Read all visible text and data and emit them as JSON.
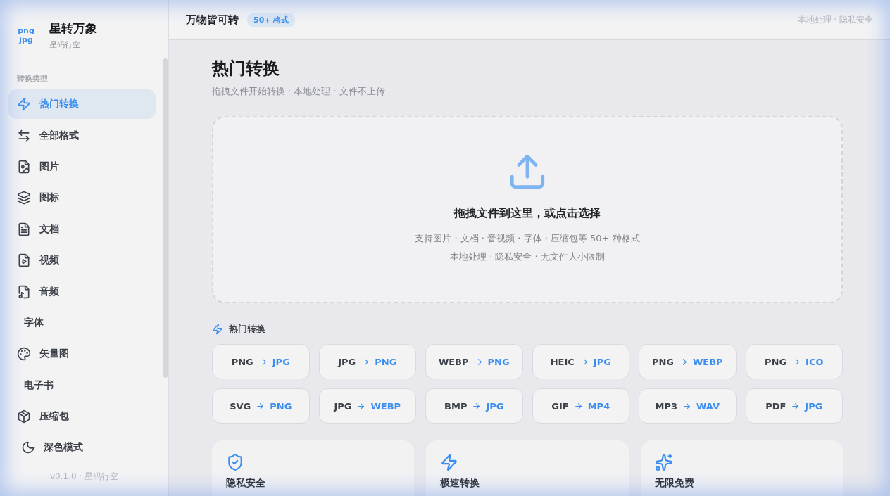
{
  "brand": {
    "logo_top": "png",
    "logo_bottom": "jpg",
    "name": "星转万象",
    "subtitle": "星码行空"
  },
  "sidebar": {
    "section": "转换类型",
    "items": [
      {
        "label": "热门转换",
        "selected": true
      },
      {
        "label": "全部格式",
        "selected": false
      },
      {
        "label": "图片",
        "selected": false
      },
      {
        "label": "图标",
        "selected": false
      },
      {
        "label": "文档",
        "selected": false
      },
      {
        "label": "视频",
        "selected": false
      },
      {
        "label": "音频",
        "selected": false
      },
      {
        "label": "字体",
        "selected": false
      },
      {
        "label": "矢量图",
        "selected": false
      },
      {
        "label": "电子书",
        "selected": false
      },
      {
        "label": "压缩包",
        "selected": false
      }
    ],
    "dark_mode": "深色模式",
    "version": "v0.1.0 · 星码行空"
  },
  "header": {
    "title": "万物皆可转",
    "badge": "50+ 格式",
    "note": "本地处理 · 隐私安全"
  },
  "page": {
    "title": "热门转换",
    "subtitle": "拖拽文件开始转换 · 本地处理 · 文件不上传"
  },
  "dropzone": {
    "title": "拖拽文件到这里，或点击选择",
    "line_1": "支持图片 · 文档 · 音视频 · 字体 · 压缩包等 50+ 种格式",
    "line_2": "本地处理 · 隐私安全 · 无文件大小限制"
  },
  "popular": {
    "heading": "热门转换",
    "conversions": [
      {
        "from": "PNG",
        "to": "JPG"
      },
      {
        "from": "JPG",
        "to": "PNG"
      },
      {
        "from": "WEBP",
        "to": "PNG"
      },
      {
        "from": "HEIC",
        "to": "JPG"
      },
      {
        "from": "PNG",
        "to": "WEBP"
      },
      {
        "from": "PNG",
        "to": "ICO"
      },
      {
        "from": "SVG",
        "to": "PNG"
      },
      {
        "from": "JPG",
        "to": "WEBP"
      },
      {
        "from": "BMP",
        "to": "JPG"
      },
      {
        "from": "GIF",
        "to": "MP4"
      },
      {
        "from": "MP3",
        "to": "WAV"
      },
      {
        "from": "PDF",
        "to": "JPG"
      }
    ]
  },
  "features": [
    {
      "title": "隐私安全"
    },
    {
      "title": "极速转换"
    },
    {
      "title": "无限免费"
    }
  ]
}
